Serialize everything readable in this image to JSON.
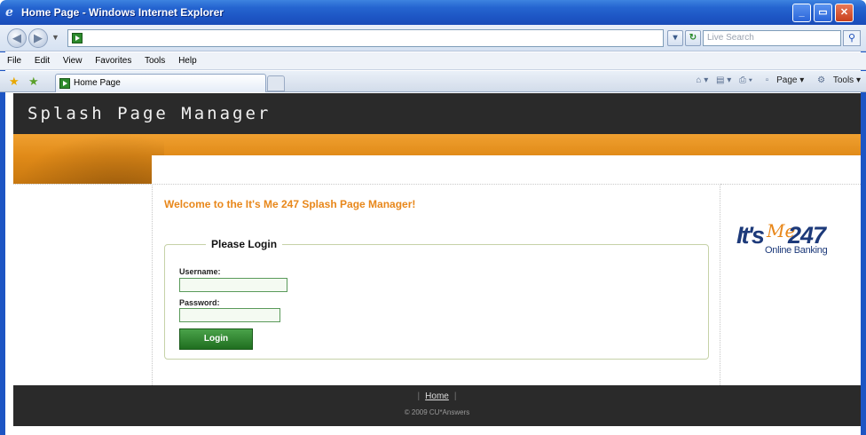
{
  "window": {
    "title": "Home Page - Windows Internet Explorer",
    "buttons": {
      "minimize": "_",
      "restore": "▭",
      "close": "✕"
    }
  },
  "addressbar": {
    "back_icon": "back-arrow-icon",
    "forward_icon": "forward-arrow-icon",
    "url": "",
    "search_placeholder": "Live Search"
  },
  "menubar": {
    "items": [
      "File",
      "Edit",
      "View",
      "Favorites",
      "Tools",
      "Help"
    ]
  },
  "tabs": {
    "active_tab_label": "Home Page"
  },
  "command_bar": {
    "page_label": "Page",
    "tools_label": "Tools"
  },
  "page": {
    "header_title": "Splash Page Manager",
    "welcome_text": "Welcome to the It's Me 247 Splash Page Manager!",
    "login": {
      "legend": "Please Login",
      "username_label": "Username:",
      "username_value": "",
      "password_label": "Password:",
      "password_value": "",
      "submit_label": "Login"
    },
    "logo": {
      "its": "It's",
      "me": "Me",
      "number": "247",
      "tagline": "Online Banking"
    },
    "footer": {
      "home_link": "Home",
      "copyright": "© 2009 CU*Answers"
    }
  },
  "colors": {
    "header_bg": "#2a2a2a",
    "accent_orange": "#e8871a",
    "button_green": "#2c8a2c",
    "logo_blue": "#1d3a7a"
  }
}
